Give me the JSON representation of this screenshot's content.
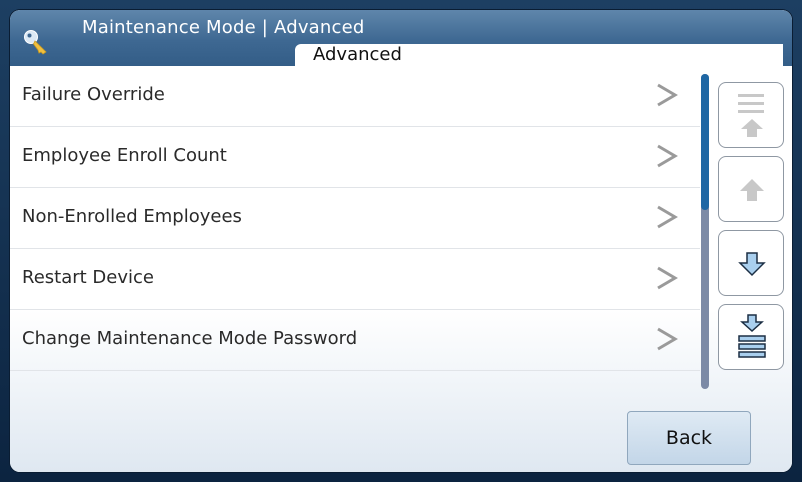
{
  "header": {
    "title": "Maintenance Mode | Advanced",
    "tab_label": "Advanced",
    "icon": "key-icon"
  },
  "menu": {
    "items": [
      {
        "label": "Failure Override"
      },
      {
        "label": "Employee Enroll Count"
      },
      {
        "label": "Non-Enrolled Employees"
      },
      {
        "label": "Restart Device"
      },
      {
        "label": "Change Maintenance Mode Password"
      }
    ],
    "item_icon": "chevron-right-icon"
  },
  "scroll_buttons": [
    {
      "name": "scroll-to-top-button",
      "icon": "page-up-icon",
      "enabled": false
    },
    {
      "name": "scroll-up-button",
      "icon": "arrow-up-icon",
      "enabled": false
    },
    {
      "name": "scroll-down-button",
      "icon": "arrow-down-icon",
      "enabled": true
    },
    {
      "name": "scroll-to-bottom-button",
      "icon": "page-down-icon",
      "enabled": true
    }
  ],
  "footer": {
    "back_label": "Back"
  },
  "colors": {
    "titlebar": "#3e6892",
    "scroll_thumb": "#1f67a4",
    "scroll_track": "#7c8aa6",
    "enabled_arrow": "#a9cfee",
    "disabled_arrow": "#c8c8c8"
  }
}
